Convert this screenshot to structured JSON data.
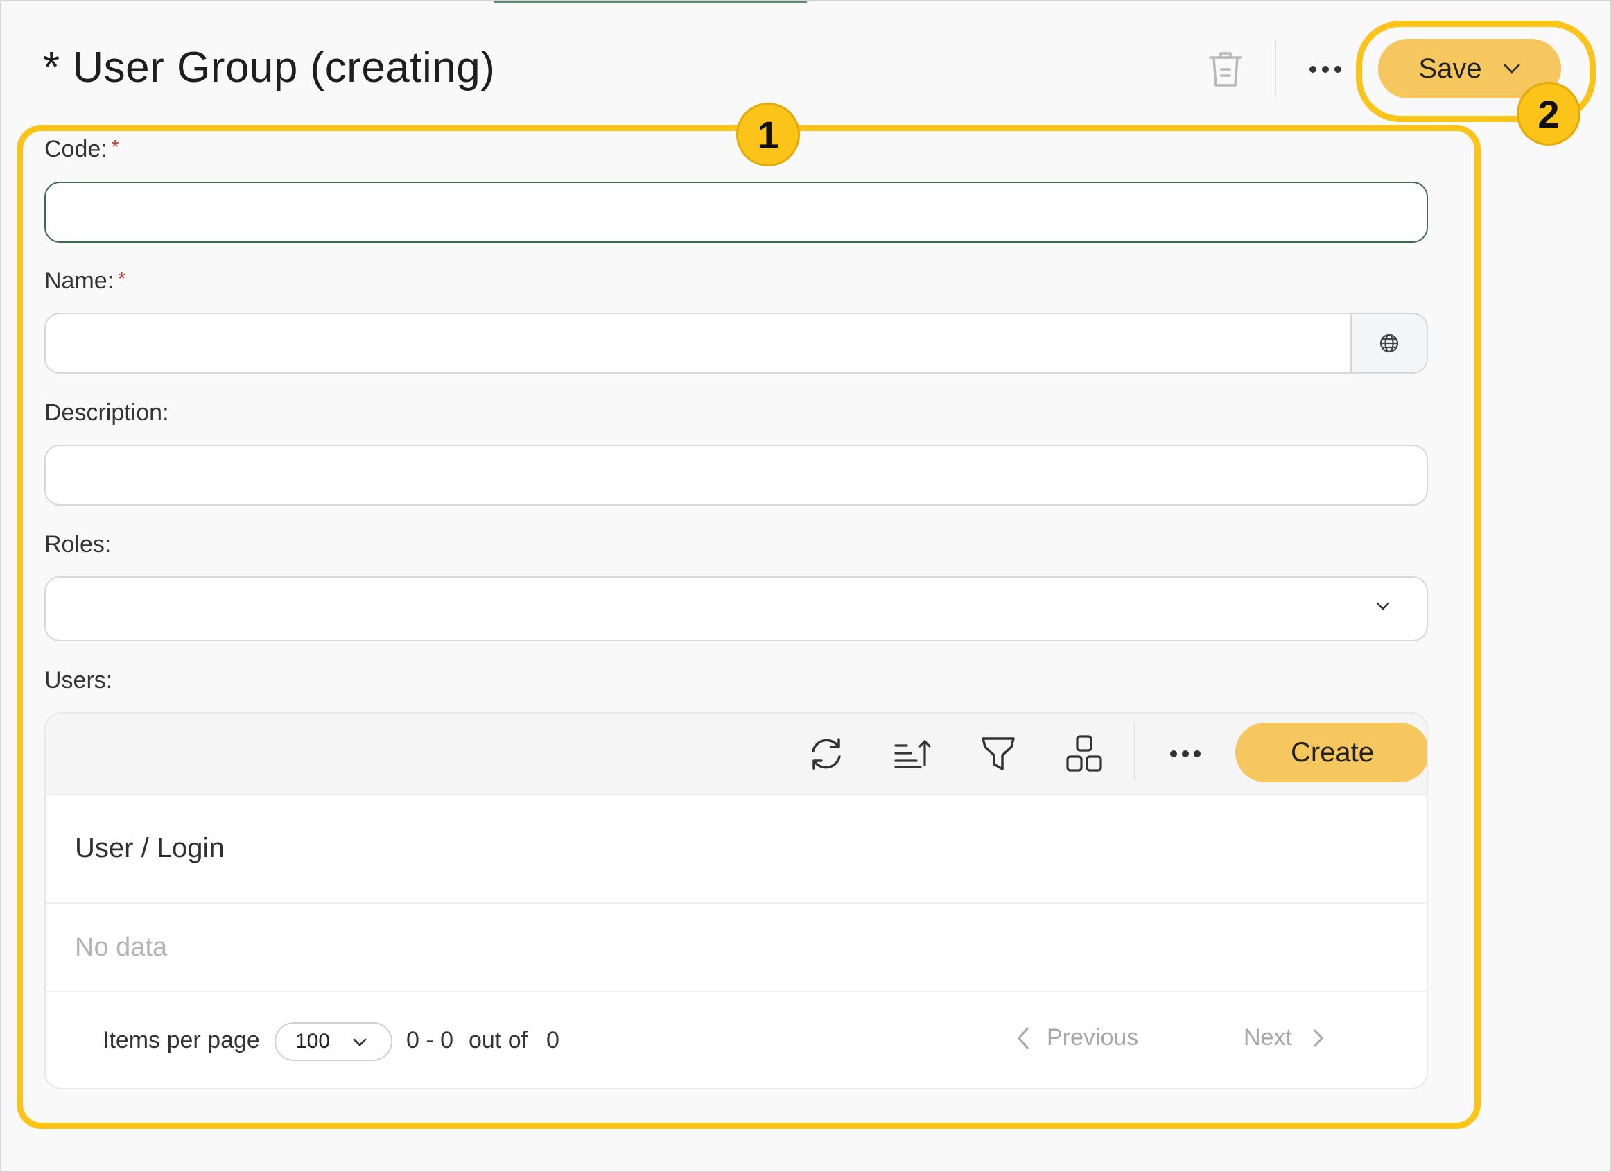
{
  "header": {
    "title": "* User Group (creating)",
    "save_label": "Save",
    "icons": {
      "delete": "trash-icon",
      "more": "more-horizontal-icon",
      "save_menu": "chevron-down-icon"
    }
  },
  "form": {
    "code": {
      "label": "Code:",
      "required_mark": "*",
      "value": ""
    },
    "name": {
      "label": "Name:",
      "required_mark": "*",
      "value": "",
      "icon": "globe-icon"
    },
    "description": {
      "label": "Description:",
      "value": ""
    },
    "roles": {
      "label": "Roles:",
      "selected": ""
    },
    "users": {
      "label": "Users:",
      "toolbar": {
        "create_label": "Create",
        "icons": [
          "refresh-icon",
          "sort-icon",
          "filter-icon",
          "layout-grid-icon",
          "more-horizontal-icon"
        ]
      },
      "columns": [
        "User / Login"
      ],
      "empty_text": "No data",
      "pagination": {
        "items_per_page_label": "Items per page",
        "items_per_page": "100",
        "range": "0 - 0",
        "out_of_label": "out of",
        "total": "0",
        "previous_label": "Previous",
        "next_label": "Next"
      }
    }
  },
  "callouts": [
    "1",
    "2"
  ],
  "colors": {
    "accent": "#f6c75f",
    "callout": "#fcc419",
    "focus_border": "#3d6b52",
    "required": "#c0392b"
  }
}
